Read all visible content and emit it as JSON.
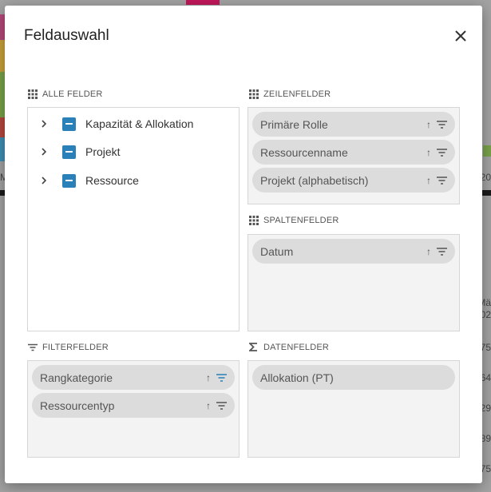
{
  "dialog": {
    "title": "Feldauswahl"
  },
  "sections": {
    "all_fields": {
      "label": "ALLE FELDER",
      "items": [
        {
          "label": "Kapazität & Allokation"
        },
        {
          "label": "Projekt"
        },
        {
          "label": "Ressource"
        }
      ]
    },
    "row_fields": {
      "label": "ZEILENFELDER",
      "chips": [
        {
          "label": "Primäre Rolle"
        },
        {
          "label": "Ressourcenname"
        },
        {
          "label": "Projekt (alphabetisch)"
        }
      ]
    },
    "column_fields": {
      "label": "SPALTENFELDER",
      "chips": [
        {
          "label": "Datum"
        }
      ]
    },
    "filter_fields": {
      "label": "FILTERFELDER",
      "chips": [
        {
          "label": "Rangkategorie",
          "filter_active": true
        },
        {
          "label": "Ressourcentyp",
          "filter_active": false
        }
      ]
    },
    "data_fields": {
      "label": "DATENFELDER",
      "chips": [
        {
          "label": "Allokation (PT)"
        }
      ]
    }
  },
  "icons": {
    "sort": "sort-ascending-icon",
    "filter": "filter-icon",
    "grid": "grid-icon",
    "sum": "sigma-icon",
    "close": "close-icon",
    "expand": "chevron-right-icon"
  },
  "colors": {
    "checkbox": "#2a80b9",
    "filter_active": "#2a80b9",
    "chip_bg": "#dcdcdc",
    "panel_gray": "#f3f3f3"
  },
  "background": {
    "right_texts": [
      "20",
      "M",
      "Mä",
      "02",
      "75",
      "64",
      "29",
      "89",
      "75"
    ]
  }
}
